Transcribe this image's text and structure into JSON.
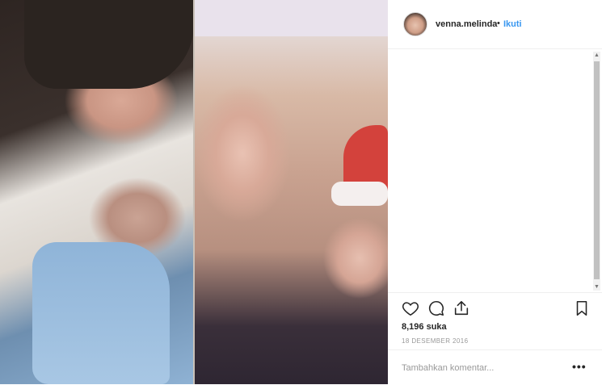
{
  "post": {
    "username": "venna.melinda",
    "separator": "•",
    "follow_label": "Ikuti",
    "likes_count": "8,196",
    "likes_word": "suka",
    "date": "18 DESEMBER 2016",
    "comment_placeholder": "Tambahkan komentar...",
    "more_label": "•••"
  },
  "icons": [
    "heart-icon",
    "comment-icon",
    "share-icon",
    "bookmark-icon"
  ],
  "colors": {
    "link_blue": "#3897f0",
    "text": "#262626",
    "muted": "#999999"
  }
}
